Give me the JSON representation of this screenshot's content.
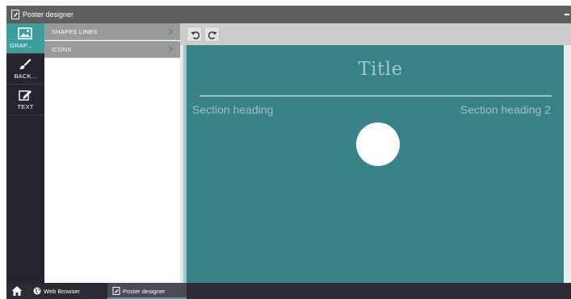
{
  "window": {
    "title": "Poster designer",
    "icon": "document-edit-icon"
  },
  "rail": {
    "items": [
      {
        "label": "GRAP...",
        "icon": "image-icon",
        "active": true
      },
      {
        "label": "BACK...",
        "icon": "paintbrush-icon",
        "active": false
      },
      {
        "label": "TEXT",
        "icon": "edit-icon",
        "active": false
      }
    ]
  },
  "subpanel": {
    "items": [
      {
        "label": "SHAPES LINES",
        "icon": "chevron-right-icon"
      },
      {
        "label": "ICONS",
        "icon": "chevron-right-icon"
      }
    ]
  },
  "toolbar": {
    "undo_icon": "undo-icon",
    "redo_icon": "redo-icon"
  },
  "poster": {
    "title": "Title",
    "section_heading_1": "Section heading",
    "section_heading_2": "Section heading 2",
    "background_color": "#378187",
    "shape": "circle"
  },
  "taskbar": {
    "home_icon": "home-icon",
    "tasks": [
      {
        "label": "Web Browser",
        "icon": "globe-icon",
        "active": false
      },
      {
        "label": "Poster designer",
        "icon": "document-edit-icon",
        "active": true
      }
    ]
  },
  "colors": {
    "accent": "#3a9f9d",
    "rail_bg": "#25242f",
    "titlebar_bg": "#5f5f5f",
    "submenu_bg": "#9a9a9a",
    "canvas_bg": "#378187"
  }
}
